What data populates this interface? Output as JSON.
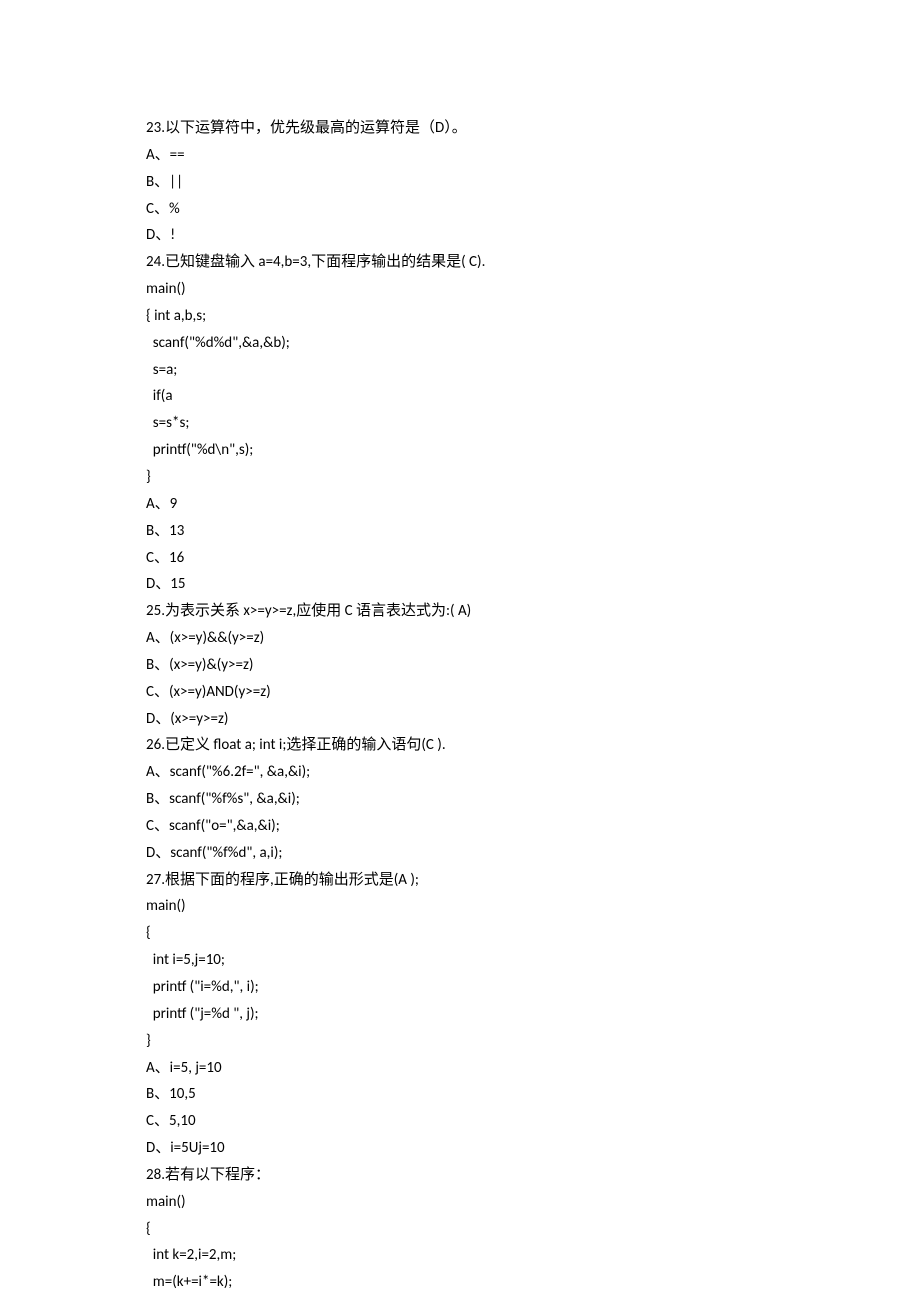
{
  "lines": [
    "23.以下运算符中，优先级最高的运算符是（D）。",
    "A、==",
    "B、||",
    "C、%",
    "D、!",
    "24.已知键盘输入 a=4,b=3,下面程序输出的结果是( C).",
    "main()",
    "{ int a,b,s;",
    "  scanf(\"%d%d\",&a,&b);",
    "  s=a;",
    "  if(a",
    "  s=s*s;",
    "  printf(\"%d\\n\",s);",
    "}",
    "A、9",
    "B、13",
    "C、16",
    "D、15",
    "25.为表示关系 x>=y>=z,应使用 C 语言表达式为:( A)",
    "A、(x>=y)&&(y>=z)",
    "B、(x>=y)&(y>=z)",
    "C、(x>=y)AND(y>=z)",
    "D、(x>=y>=z)",
    "26.已定义 float a; int i;选择正确的输入语句(C ).",
    "A、scanf(\"%6.2f=\", &a,&i);",
    "B、scanf(\"%f%s\", &a,&i);",
    "C、scanf(\"o=\",&a,&i);",
    "D、scanf(\"%f%d\", a,i);",
    "27.根据下面的程序,正确的输出形式是(A );",
    "main()",
    "{",
    "  int i=5,j=10;",
    "  printf (\"i=%d,\", i);",
    "  printf (\"j=%d \", j);",
    "}",
    "A、i=5, j=10",
    "B、10,5",
    "C、5,10",
    "D、i=5Uj=10",
    "28.若有以下程序：",
    "main()",
    "{",
    "  int k=2,i=2,m;",
    "  m=(k+=i*=k);"
  ]
}
